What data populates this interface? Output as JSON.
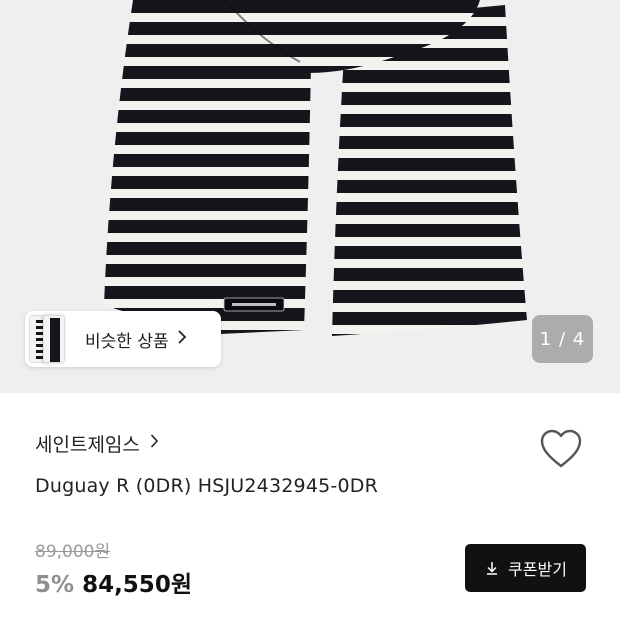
{
  "gallery": {
    "similar_label": "비슷한 상품",
    "page_indicator": "1 / 4"
  },
  "product": {
    "brand": "세인트제임스",
    "name": "Duguay R (0DR) HSJU2432945-0DR",
    "original_price": "89,000원",
    "discount_rate": "5%",
    "sale_price": "84,550원"
  },
  "actions": {
    "coupon_label": "쿠폰받기"
  },
  "icons": {
    "brand_chevron": "chevron-right-icon",
    "similar_chevron": "chevron-right-icon",
    "wishlist": "heart-outline-icon",
    "coupon": "download-icon"
  },
  "colors": {
    "stripe_dark": "#15161c",
    "stripe_light": "#f2f2ee",
    "gallery_bg": "#efefef",
    "coupon_bg": "#111111",
    "discount": "#8f8f8f"
  }
}
